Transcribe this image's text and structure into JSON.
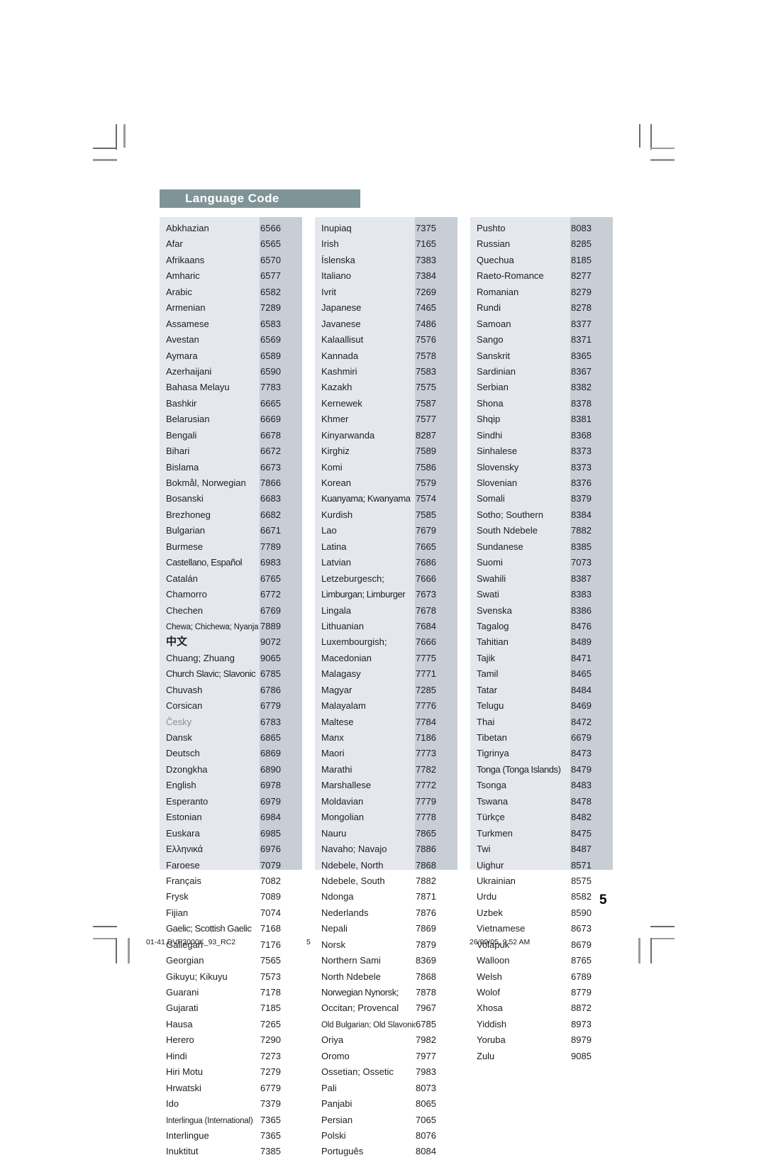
{
  "document": {
    "section_title": "Language Code",
    "page_number": "5",
    "accent_color": "#7f9497",
    "table_name_bg": "#e4e7ec",
    "table_code_bg": "#c7ced6"
  },
  "footer": {
    "file_label": "01-41 DVP3000K_93_RC2",
    "page_label": "5",
    "timestamp": "26/09/05, 9:52 AM"
  },
  "columns": [
    {
      "id": "column-1",
      "rows": [
        {
          "name": "Abkhazian",
          "code": "6566"
        },
        {
          "name": "Afar",
          "code": "6565"
        },
        {
          "name": "Afrikaans",
          "code": "6570"
        },
        {
          "name": "Amharic",
          "code": "6577"
        },
        {
          "name": "Arabic",
          "code": "6582"
        },
        {
          "name": "Armenian",
          "code": "7289"
        },
        {
          "name": "Assamese",
          "code": "6583"
        },
        {
          "name": "Avestan",
          "code": "6569"
        },
        {
          "name": "Aymara",
          "code": "6589"
        },
        {
          "name": "Azerhaijani",
          "code": "6590"
        },
        {
          "name": "Bahasa Melayu",
          "code": "7783"
        },
        {
          "name": "Bashkir",
          "code": "6665"
        },
        {
          "name": "Belarusian",
          "code": "6669"
        },
        {
          "name": "Bengali",
          "code": "6678"
        },
        {
          "name": "Bihari",
          "code": "6672"
        },
        {
          "name": "Bislama",
          "code": "6673"
        },
        {
          "name": "Bokmål, Norwegian",
          "code": "7866"
        },
        {
          "name": "Bosanski",
          "code": "6683"
        },
        {
          "name": "Brezhoneg",
          "code": "6682"
        },
        {
          "name": "Bulgarian",
          "code": "6671"
        },
        {
          "name": "Burmese",
          "code": "7789"
        },
        {
          "name": "Castellano, Español",
          "code": "6983",
          "style": "tight"
        },
        {
          "name": "Catalán",
          "code": "6765"
        },
        {
          "name": "Chamorro",
          "code": "6772"
        },
        {
          "name": "Chechen",
          "code": "6769"
        },
        {
          "name": "Chewa; Chichewa; Nyanja",
          "code": "7889",
          "style": "condensed"
        },
        {
          "name": "中文",
          "code": "9072",
          "style": "cjk"
        },
        {
          "name": "Chuang; Zhuang",
          "code": "9065"
        },
        {
          "name": "Church Slavic; Slavonic",
          "code": "6785",
          "style": "tight"
        },
        {
          "name": "Chuvash",
          "code": "6786"
        },
        {
          "name": "Corsican",
          "code": "6779"
        },
        {
          "name": "Česky",
          "code": "6783",
          "style": "muted"
        },
        {
          "name": "Dansk",
          "code": "6865"
        },
        {
          "name": "Deutsch",
          "code": "6869"
        },
        {
          "name": "Dzongkha",
          "code": "6890"
        },
        {
          "name": "English",
          "code": "6978"
        },
        {
          "name": "Esperanto",
          "code": "6979"
        },
        {
          "name": "Estonian",
          "code": "6984"
        },
        {
          "name": "Euskara",
          "code": "6985"
        },
        {
          "name": "Ελληνικά",
          "code": "6976"
        },
        {
          "name": "Faroese",
          "code": "7079"
        },
        {
          "name": "Français",
          "code": "7082"
        },
        {
          "name": "Frysk",
          "code": "7089"
        },
        {
          "name": "Fijian",
          "code": "7074"
        },
        {
          "name": "Gaelic; Scottish Gaelic",
          "code": "7168",
          "style": "tight"
        },
        {
          "name": "Gallegan",
          "code": "7176"
        },
        {
          "name": "Georgian",
          "code": "7565"
        },
        {
          "name": "Gikuyu; Kikuyu",
          "code": "7573"
        },
        {
          "name": "Guarani",
          "code": "7178"
        },
        {
          "name": "Gujarati",
          "code": "7185"
        },
        {
          "name": "Hausa",
          "code": "7265"
        },
        {
          "name": "Herero",
          "code": "7290"
        },
        {
          "name": "Hindi",
          "code": "7273"
        },
        {
          "name": "Hiri Motu",
          "code": "7279"
        },
        {
          "name": "Hrwatski",
          "code": "6779"
        },
        {
          "name": "Ido",
          "code": "7379"
        },
        {
          "name": "Interlingua (International)",
          "code": "7365",
          "style": "condensed"
        },
        {
          "name": "Interlingue",
          "code": "7365"
        },
        {
          "name": "Inuktitut",
          "code": "7385"
        }
      ]
    },
    {
      "id": "column-2",
      "rows": [
        {
          "name": "Inupiaq",
          "code": "7375"
        },
        {
          "name": "Irish",
          "code": "7165"
        },
        {
          "name": "Íslenska",
          "code": "7383"
        },
        {
          "name": "Italiano",
          "code": "7384"
        },
        {
          "name": "Ivrit",
          "code": "7269"
        },
        {
          "name": "Japanese",
          "code": "7465"
        },
        {
          "name": "Javanese",
          "code": "7486"
        },
        {
          "name": "Kalaallisut",
          "code": "7576"
        },
        {
          "name": "Kannada",
          "code": "7578"
        },
        {
          "name": "Kashmiri",
          "code": "7583"
        },
        {
          "name": "Kazakh",
          "code": "7575"
        },
        {
          "name": "Kernewek",
          "code": "7587"
        },
        {
          "name": "Khmer",
          "code": "7577"
        },
        {
          "name": "Kinyarwanda",
          "code": "8287"
        },
        {
          "name": "Kirghiz",
          "code": "7589"
        },
        {
          "name": "Komi",
          "code": "7586"
        },
        {
          "name": "Korean",
          "code": "7579"
        },
        {
          "name": "Kuanyama; Kwanyama",
          "code": "7574",
          "style": "tight"
        },
        {
          "name": "Kurdish",
          "code": "7585"
        },
        {
          "name": "Lao",
          "code": "7679"
        },
        {
          "name": "Latina",
          "code": "7665"
        },
        {
          "name": "Latvian",
          "code": "7686"
        },
        {
          "name": "Letzeburgesch;",
          "code": "7666"
        },
        {
          "name": "Limburgan; Limburger",
          "code": "7673",
          "style": "tight"
        },
        {
          "name": "Lingala",
          "code": "7678"
        },
        {
          "name": "Lithuanian",
          "code": "7684"
        },
        {
          "name": "Luxembourgish;",
          "code": "7666"
        },
        {
          "name": "Macedonian",
          "code": "7775"
        },
        {
          "name": "Malagasy",
          "code": "7771"
        },
        {
          "name": "Magyar",
          "code": "7285"
        },
        {
          "name": "Malayalam",
          "code": "7776"
        },
        {
          "name": "Maltese",
          "code": "7784"
        },
        {
          "name": "Manx",
          "code": "7186"
        },
        {
          "name": "Maori",
          "code": "7773"
        },
        {
          "name": "Marathi",
          "code": "7782"
        },
        {
          "name": "Marshallese",
          "code": "7772"
        },
        {
          "name": "Moldavian",
          "code": "7779"
        },
        {
          "name": "Mongolian",
          "code": "7778"
        },
        {
          "name": "Nauru",
          "code": "7865"
        },
        {
          "name": "Navaho; Navajo",
          "code": "7886"
        },
        {
          "name": "Ndebele, North",
          "code": "7868"
        },
        {
          "name": "Ndebele, South",
          "code": "7882"
        },
        {
          "name": "Ndonga",
          "code": "7871"
        },
        {
          "name": "Nederlands",
          "code": "7876"
        },
        {
          "name": "Nepali",
          "code": "7869"
        },
        {
          "name": "Norsk",
          "code": "7879"
        },
        {
          "name": "Northern Sami",
          "code": "8369"
        },
        {
          "name": "North Ndebele",
          "code": "7868"
        },
        {
          "name": "Norwegian Nynorsk;",
          "code": "7878",
          "style": "tight"
        },
        {
          "name": "Occitan; Provencal",
          "code": "7967"
        },
        {
          "name": "Old Bulgarian; Old Slavonic",
          "code": "6785",
          "style": "condensed"
        },
        {
          "name": "Oriya",
          "code": "7982"
        },
        {
          "name": "Oromo",
          "code": "7977"
        },
        {
          "name": "Ossetian; Ossetic",
          "code": "7983"
        },
        {
          "name": "Pali",
          "code": "8073"
        },
        {
          "name": "Panjabi",
          "code": "8065"
        },
        {
          "name": "Persian",
          "code": "7065"
        },
        {
          "name": "Polski",
          "code": "8076"
        },
        {
          "name": "Português",
          "code": "8084"
        }
      ]
    },
    {
      "id": "column-3",
      "rows": [
        {
          "name": "Pushto",
          "code": "8083"
        },
        {
          "name": "Russian",
          "code": "8285"
        },
        {
          "name": "Quechua",
          "code": "8185"
        },
        {
          "name": "Raeto-Romance",
          "code": "8277"
        },
        {
          "name": "Romanian",
          "code": "8279"
        },
        {
          "name": "Rundi",
          "code": "8278"
        },
        {
          "name": "Samoan",
          "code": "8377"
        },
        {
          "name": "Sango",
          "code": "8371"
        },
        {
          "name": "Sanskrit",
          "code": "8365"
        },
        {
          "name": "Sardinian",
          "code": "8367"
        },
        {
          "name": "Serbian",
          "code": "8382"
        },
        {
          "name": "Shona",
          "code": "8378"
        },
        {
          "name": "Shqip",
          "code": "8381"
        },
        {
          "name": "Sindhi",
          "code": "8368"
        },
        {
          "name": "Sinhalese",
          "code": "8373"
        },
        {
          "name": "Slovensky",
          "code": "8373"
        },
        {
          "name": "Slovenian",
          "code": "8376"
        },
        {
          "name": "Somali",
          "code": "8379"
        },
        {
          "name": "Sotho; Southern",
          "code": "8384"
        },
        {
          "name": "South Ndebele",
          "code": "7882"
        },
        {
          "name": "Sundanese",
          "code": "8385"
        },
        {
          "name": "Suomi",
          "code": "7073"
        },
        {
          "name": "Swahili",
          "code": "8387"
        },
        {
          "name": "Swati",
          "code": "8383"
        },
        {
          "name": "Svenska",
          "code": "8386"
        },
        {
          "name": "Tagalog",
          "code": "8476"
        },
        {
          "name": "Tahitian",
          "code": "8489"
        },
        {
          "name": "Tajik",
          "code": "8471"
        },
        {
          "name": "Tamil",
          "code": "8465"
        },
        {
          "name": "Tatar",
          "code": "8484"
        },
        {
          "name": "Telugu",
          "code": "8469"
        },
        {
          "name": "Thai",
          "code": "8472"
        },
        {
          "name": "Tibetan",
          "code": "6679"
        },
        {
          "name": "Tigrinya",
          "code": "8473"
        },
        {
          "name": "Tonga (Tonga Islands)",
          "code": "8479",
          "style": "tight"
        },
        {
          "name": "Tsonga",
          "code": "8483"
        },
        {
          "name": "Tswana",
          "code": "8478"
        },
        {
          "name": "Türkçe",
          "code": "8482"
        },
        {
          "name": "Turkmen",
          "code": "8475"
        },
        {
          "name": "Twi",
          "code": "8487"
        },
        {
          "name": "Uighur",
          "code": "8571"
        },
        {
          "name": "Ukrainian",
          "code": "8575"
        },
        {
          "name": "Urdu",
          "code": "8582"
        },
        {
          "name": "Uzbek",
          "code": "8590"
        },
        {
          "name": "Vietnamese",
          "code": "8673"
        },
        {
          "name": "Volapuk",
          "code": "8679"
        },
        {
          "name": "Walloon",
          "code": "8765"
        },
        {
          "name": "Welsh",
          "code": "6789"
        },
        {
          "name": "Wolof",
          "code": "8779"
        },
        {
          "name": "Xhosa",
          "code": "8872"
        },
        {
          "name": "Yiddish",
          "code": "8973"
        },
        {
          "name": "Yoruba",
          "code": "8979"
        },
        {
          "name": "Zulu",
          "code": "9085"
        }
      ]
    }
  ]
}
